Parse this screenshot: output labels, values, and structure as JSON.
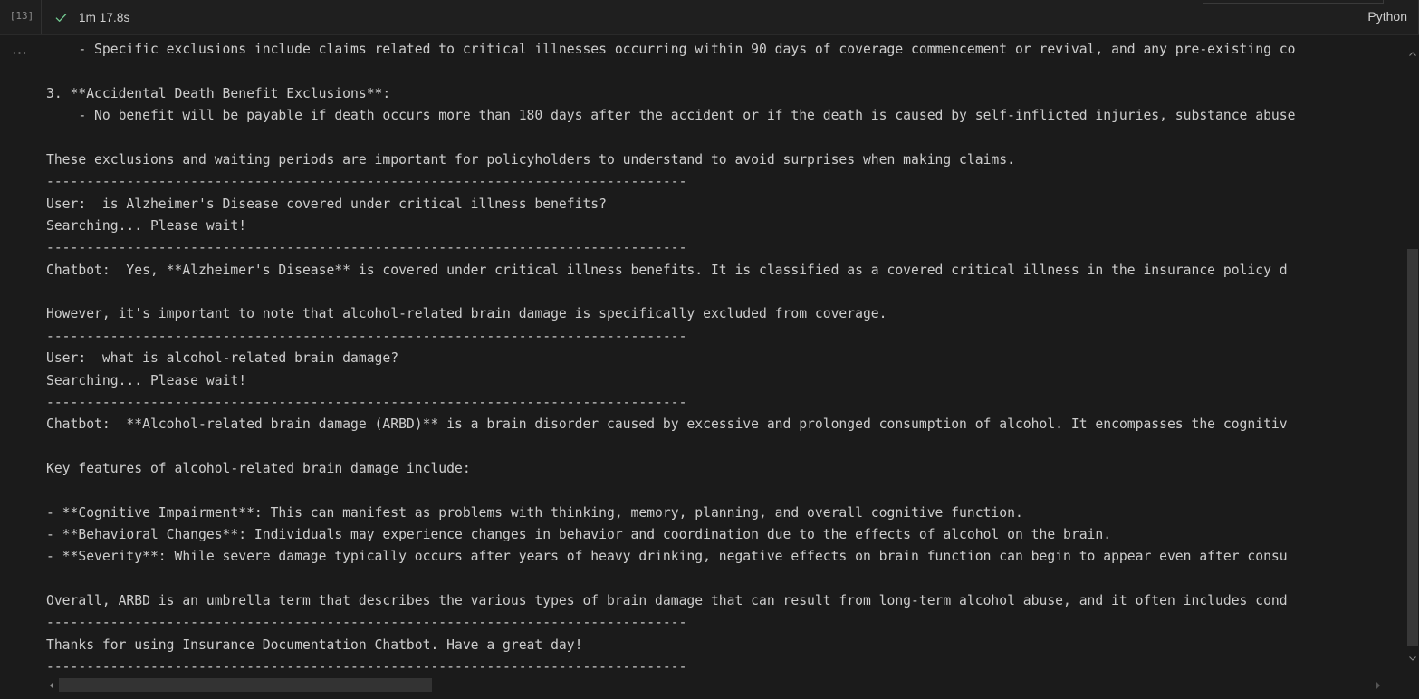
{
  "cell": {
    "execution_count": "[13]",
    "status_icon": "check-icon",
    "run_time": "1m 17.8s",
    "kernel_language": "Python",
    "more_actions": "⋯"
  },
  "output": {
    "lines": [
      "  - - - - - - - - - - - - - - - - - - - - - - - - - - - - - - - - - - - - - - -",
      "    - Specific exclusions include claims related to critical illnesses occurring within 90 days of coverage commencement or revival, and any pre-existing co",
      "",
      "3. **Accidental Death Benefit Exclusions**:",
      "    - No benefit will be payable if death occurs more than 180 days after the accident or if the death is caused by self-inflicted injuries, substance abuse",
      "",
      "These exclusions and waiting periods are important for policyholders to understand to avoid surprises when making claims.",
      "--------------------------------------------------------------------------------",
      "User:  is Alzheimer's Disease covered under critical illness benefits?",
      "Searching... Please wait!",
      "--------------------------------------------------------------------------------",
      "Chatbot:  Yes, **Alzheimer's Disease** is covered under critical illness benefits. It is classified as a covered critical illness in the insurance policy d",
      "",
      "However, it's important to note that alcohol-related brain damage is specifically excluded from coverage.",
      "--------------------------------------------------------------------------------",
      "User:  what is alcohol-related brain damage?",
      "Searching... Please wait!",
      "--------------------------------------------------------------------------------",
      "Chatbot:  **Alcohol-related brain damage (ARBD)** is a brain disorder caused by excessive and prolonged consumption of alcohol. It encompasses the cognitiv",
      "",
      "Key features of alcohol-related brain damage include:",
      "",
      "- **Cognitive Impairment**: This can manifest as problems with thinking, memory, planning, and overall cognitive function.",
      "- **Behavioral Changes**: Individuals may experience changes in behavior and coordination due to the effects of alcohol on the brain.",
      "- **Severity**: While severe damage typically occurs after years of heavy drinking, negative effects on brain function can begin to appear even after consu",
      "",
      "Overall, ARBD is an umbrella term that describes the various types of brain damage that can result from long-term alcohol abuse, and it often includes cond",
      "--------------------------------------------------------------------------------",
      "Thanks for using Insurance Documentation Chatbot. Have a great day!",
      "--------------------------------------------------------------------------------"
    ]
  },
  "scrollbars": {
    "vertical_up_icon": "chevron-up-icon",
    "vertical_down_icon": "chevron-down-icon",
    "horizontal_left_icon": "chevron-left-icon",
    "horizontal_right_icon": "chevron-right-icon"
  },
  "colors": {
    "background": "#1b1b1b",
    "header_background": "#1f1f1f",
    "text": "#cdcdcd",
    "success_green": "#73c991",
    "muted": "#8a8a8a",
    "scrollbar_thumb": "#383838"
  }
}
